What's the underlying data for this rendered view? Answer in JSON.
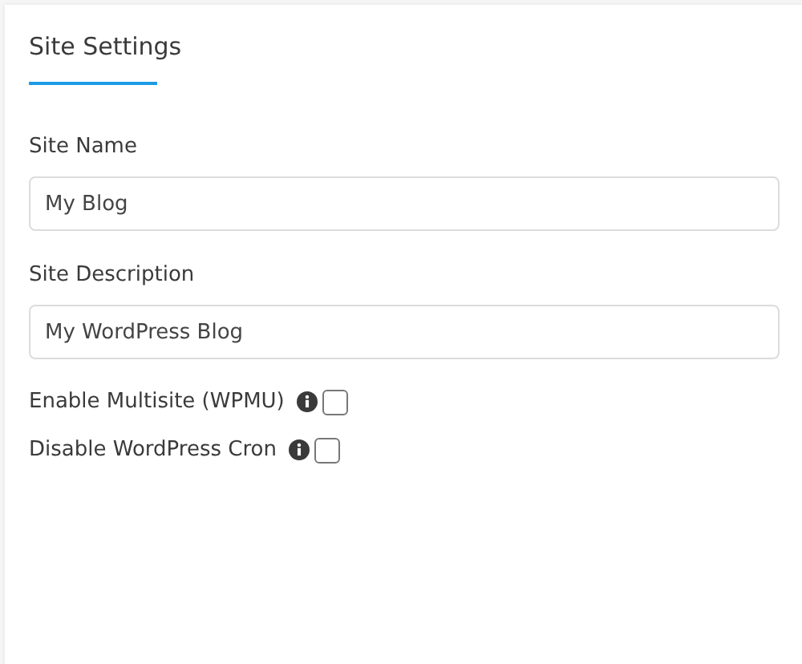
{
  "title": "Site Settings",
  "fields": [
    {
      "label": "Site Name",
      "value": "My Blog"
    },
    {
      "label": "Site Description",
      "value": "My WordPress Blog"
    }
  ],
  "options": [
    {
      "label": "Enable Multisite (WPMU)",
      "checked": false
    },
    {
      "label": "Disable WordPress Cron",
      "checked": false
    }
  ]
}
